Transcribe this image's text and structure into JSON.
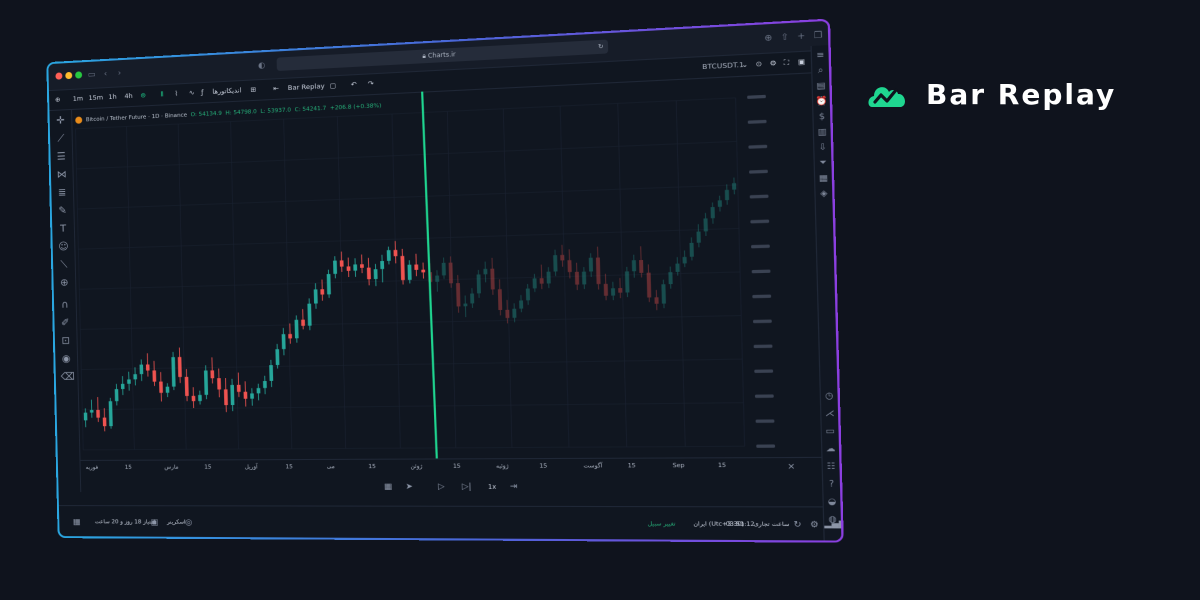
{
  "brand": {
    "title": "Bar Replay",
    "accent": "#1fd690"
  },
  "browser": {
    "url": "Charts.ir"
  },
  "toolbar": {
    "intervals": [
      "1m",
      "15m",
      "1h",
      "4h"
    ],
    "indicators_label": "اندیکاتورها",
    "bar_replay_label": "Bar Replay",
    "symbol": "BTCUSDT.1"
  },
  "legend": {
    "name": "Bitcoin / Tether Future",
    "interval": "1D",
    "exchange": "Binance",
    "open": "O: 54134.9",
    "high": "H: 54798.0",
    "low": "L: 53937.0",
    "close": "C: 54241.7",
    "change": "+206.8 (+0.38%)"
  },
  "time_axis_labels": [
    "فوریه",
    "15",
    "مارس",
    "15",
    "آوریل",
    "15",
    "می",
    "15",
    "ژوئن",
    "15",
    "ژوئیه",
    "15",
    "آگوست",
    "15",
    "Sep",
    "15"
  ],
  "status": {
    "date": "امتیاز 18 روز و 20 ساعت",
    "screener": "اسکرینر",
    "time": "03:51:12",
    "timezone": "ایران (Utc+3:30)",
    "session": "ساعت تجاری",
    "edit": "تغییر سبیل"
  },
  "colors": {
    "up": "#26a69a",
    "down": "#ef5350",
    "replay_line": "#1fd690"
  },
  "chart_data": {
    "type": "candlestick",
    "replay_split_index": 53,
    "candles": [
      [
        50,
        51.4,
        49.2,
        50.9
      ],
      [
        50.9,
        52.4,
        50.3,
        51.2
      ],
      [
        51.2,
        52.7,
        49.8,
        50.3
      ],
      [
        50.3,
        51.4,
        48.7,
        49.3
      ],
      [
        49.3,
        52.6,
        49,
        52.2
      ],
      [
        52.2,
        54.2,
        51.7,
        53.6
      ],
      [
        53.6,
        55.1,
        52.9,
        54.2
      ],
      [
        54.2,
        55.6,
        53.4,
        54.7
      ],
      [
        54.7,
        56.1,
        54,
        55.3
      ],
      [
        55.3,
        57,
        54.5,
        56.4
      ],
      [
        56.4,
        57.7,
        55,
        55.7
      ],
      [
        55.7,
        56.8,
        53.9,
        54.4
      ],
      [
        54.4,
        55.5,
        52.1,
        53.1
      ],
      [
        53.1,
        54.2,
        52.6,
        53.8
      ],
      [
        53.8,
        57.8,
        53.4,
        57.2
      ],
      [
        57.2,
        58.3,
        54.2,
        54.9
      ],
      [
        54.9,
        55.8,
        52.1,
        52.7
      ],
      [
        52.7,
        53.7,
        51.3,
        52.1
      ],
      [
        52.1,
        53.3,
        51.7,
        52.8
      ],
      [
        52.8,
        56.2,
        52.3,
        55.6
      ],
      [
        55.6,
        57.1,
        54.1,
        54.7
      ],
      [
        54.7,
        55.8,
        52.5,
        53.4
      ],
      [
        53.4,
        54.7,
        50.8,
        51.6
      ],
      [
        51.6,
        54.6,
        50.9,
        53.9
      ],
      [
        53.9,
        55.3,
        52.5,
        53.1
      ],
      [
        53.1,
        54.3,
        51.4,
        52.3
      ],
      [
        52.3,
        53.5,
        51.5,
        52.9
      ],
      [
        52.9,
        54,
        52.1,
        53.5
      ],
      [
        53.5,
        54.9,
        52.8,
        54.3
      ],
      [
        54.3,
        56.7,
        53.6,
        56.1
      ],
      [
        56.1,
        58.5,
        55.7,
        57.9
      ],
      [
        57.9,
        60.3,
        57.2,
        59.6
      ],
      [
        59.6,
        60.8,
        58.5,
        59.1
      ],
      [
        59.1,
        61.7,
        58.6,
        61.2
      ],
      [
        61.2,
        62.4,
        60.1,
        60.5
      ],
      [
        60.5,
        63.6,
        60,
        63
      ],
      [
        63,
        65.3,
        62.4,
        64.6
      ],
      [
        64.6,
        65.7,
        63.3,
        64
      ],
      [
        64,
        66.8,
        63.6,
        66.3
      ],
      [
        66.3,
        68.3,
        65.8,
        67.8
      ],
      [
        67.8,
        68.8,
        66.5,
        67.1
      ],
      [
        67.1,
        68.1,
        65.9,
        66.6
      ],
      [
        66.6,
        68,
        65.9,
        67.3
      ],
      [
        67.3,
        68.4,
        66.3,
        66.9
      ],
      [
        66.9,
        68,
        64.9,
        65.6
      ],
      [
        65.6,
        67.3,
        64.8,
        66.7
      ],
      [
        66.7,
        68.3,
        65.2,
        67.6
      ],
      [
        67.6,
        69.2,
        67.2,
        68.8
      ],
      [
        68.8,
        69.8,
        67.3,
        68.1
      ],
      [
        68.1,
        68.9,
        64.9,
        65.4
      ],
      [
        65.4,
        67.6,
        65,
        67.1
      ],
      [
        67.1,
        68.3,
        65.8,
        66.5
      ],
      [
        66.5,
        67.3,
        65.5,
        66.2
      ],
      [
        66.2,
        67.2,
        64.5,
        65.1
      ],
      [
        65.1,
        66.4,
        64,
        65.8
      ],
      [
        65.8,
        67.8,
        65.4,
        67.2
      ],
      [
        67.2,
        67.9,
        64.4,
        64.9
      ],
      [
        64.9,
        65.8,
        61.6,
        62.3
      ],
      [
        62.3,
        63.5,
        61.1,
        62.6
      ],
      [
        62.6,
        64.3,
        62.1,
        63.7
      ],
      [
        63.7,
        66.3,
        63.2,
        65.8
      ],
      [
        65.8,
        67.2,
        64.9,
        66.4
      ],
      [
        66.4,
        67.6,
        63.5,
        64.1
      ],
      [
        64.1,
        65.2,
        61.2,
        61.8
      ],
      [
        61.8,
        62.9,
        60.3,
        60.9
      ],
      [
        60.9,
        62.5,
        60.4,
        61.9
      ],
      [
        61.9,
        63.4,
        61.5,
        62.8
      ],
      [
        62.8,
        64.6,
        62.3,
        64.1
      ],
      [
        64.1,
        65.7,
        63.7,
        65.2
      ],
      [
        65.2,
        66.7,
        64,
        64.6
      ],
      [
        64.6,
        66.4,
        64.1,
        65.9
      ],
      [
        65.9,
        68.3,
        65.4,
        67.7
      ],
      [
        67.7,
        68.8,
        66.4,
        67.1
      ],
      [
        67.1,
        68.3,
        65.1,
        65.8
      ],
      [
        65.8,
        66.8,
        63.8,
        64.4
      ],
      [
        64.4,
        66.3,
        63.9,
        65.8
      ],
      [
        65.8,
        67.8,
        65.2,
        67.3
      ],
      [
        67.3,
        68.5,
        63.8,
        64.4
      ],
      [
        64.4,
        65.5,
        62.6,
        63.1
      ],
      [
        63.1,
        64.6,
        62.6,
        63.9
      ],
      [
        63.9,
        65,
        62.8,
        63.4
      ],
      [
        63.4,
        66.2,
        62.9,
        65.7
      ],
      [
        65.7,
        67.5,
        65,
        66.9
      ],
      [
        66.9,
        68.4,
        65,
        65.5
      ],
      [
        65.5,
        66.4,
        62.3,
        62.8
      ],
      [
        62.8,
        63.6,
        61.4,
        62.1
      ],
      [
        62.1,
        64.7,
        61.6,
        64.2
      ],
      [
        64.2,
        66.1,
        63.7,
        65.5
      ],
      [
        65.5,
        67.1,
        65.1,
        66.4
      ],
      [
        66.4,
        67.8,
        66,
        67.1
      ],
      [
        67.1,
        69.2,
        66.7,
        68.6
      ],
      [
        68.6,
        70.6,
        68.1,
        69.8
      ],
      [
        69.8,
        71.8,
        69.3,
        71.2
      ],
      [
        71.2,
        72.9,
        70.6,
        72.4
      ],
      [
        72.4,
        73.6,
        71.9,
        73.1
      ],
      [
        73.1,
        74.8,
        72.6,
        74.2
      ],
      [
        74.2,
        75.5,
        73.7,
        74.9
      ]
    ]
  }
}
